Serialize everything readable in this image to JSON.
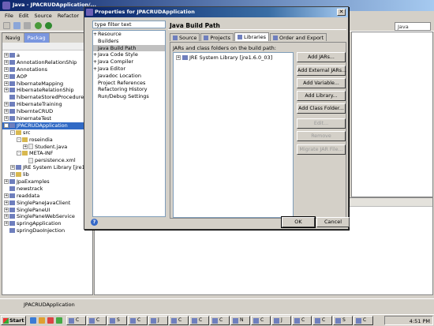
{
  "eclipse": {
    "title": "Java - JPACRUDApplication/...",
    "menu": [
      "File",
      "Edit",
      "Source",
      "Refactor",
      "Naviga"
    ],
    "perspective": "Java",
    "left_tabs": [
      "Navig",
      "Packag"
    ],
    "tree": [
      {
        "label": "a",
        "kind": "project",
        "indent": 0,
        "toggle": "+"
      },
      {
        "label": "AnnotationRelationShip",
        "kind": "project",
        "indent": 0,
        "toggle": "+"
      },
      {
        "label": "Annotations",
        "kind": "project",
        "indent": 0,
        "toggle": "+"
      },
      {
        "label": "AOP",
        "kind": "project",
        "indent": 0,
        "toggle": "+"
      },
      {
        "label": "hibernateMapping",
        "kind": "project",
        "indent": 0,
        "toggle": "+"
      },
      {
        "label": "HibernateRelationShip",
        "kind": "project",
        "indent": 0,
        "toggle": "+"
      },
      {
        "label": "hibernateStoredProcedure",
        "kind": "project",
        "indent": 0,
        "toggle": ""
      },
      {
        "label": "HibernateTraining",
        "kind": "project",
        "indent": 0,
        "toggle": "+"
      },
      {
        "label": "hibernteCRUD",
        "kind": "project",
        "indent": 0,
        "toggle": "+"
      },
      {
        "label": "hinernateTest",
        "kind": "project",
        "indent": 0,
        "toggle": "+"
      },
      {
        "label": "JPACRUDApplication",
        "kind": "project",
        "indent": 0,
        "toggle": "-",
        "selected": true
      },
      {
        "label": "src",
        "kind": "folder",
        "indent": 1,
        "toggle": "-"
      },
      {
        "label": "roseindia",
        "kind": "folder",
        "indent": 2,
        "toggle": "-"
      },
      {
        "label": "Student.java",
        "kind": "file",
        "indent": 3,
        "toggle": "+"
      },
      {
        "label": "META-INF",
        "kind": "folder",
        "indent": 2,
        "toggle": "-"
      },
      {
        "label": "persistence.xml",
        "kind": "file",
        "indent": 3,
        "toggle": ""
      },
      {
        "label": "JRE System Library [jre1.6...",
        "kind": "project",
        "indent": 1,
        "toggle": "+"
      },
      {
        "label": "lib",
        "kind": "folder",
        "indent": 1,
        "toggle": "+"
      },
      {
        "label": "JpaExamples",
        "kind": "project",
        "indent": 0,
        "toggle": "+"
      },
      {
        "label": "newstrack",
        "kind": "project",
        "indent": 0,
        "toggle": ""
      },
      {
        "label": "readdata",
        "kind": "project",
        "indent": 0,
        "toggle": "+"
      },
      {
        "label": "SinglePaneJavaClient",
        "kind": "project",
        "indent": 0,
        "toggle": "+"
      },
      {
        "label": "SinglePaneUI",
        "kind": "project",
        "indent": 0,
        "toggle": "+"
      },
      {
        "label": "SinglePaneWebService",
        "kind": "project",
        "indent": 0,
        "toggle": "+"
      },
      {
        "label": "springApplication",
        "kind": "project",
        "indent": 0,
        "toggle": "+"
      },
      {
        "label": "springDaoInjection",
        "kind": "project",
        "indent": 0,
        "toggle": ""
      }
    ],
    "status": "JPACRUDApplication"
  },
  "dialog": {
    "title": "Properties for JPACRUDApplication",
    "filter_placeholder": "type filter text",
    "nav": [
      {
        "label": "Resource",
        "expand": "+",
        "selected": false
      },
      {
        "label": "Builders",
        "expand": "",
        "selected": false
      },
      {
        "label": "Java Build Path",
        "expand": "",
        "selected": true
      },
      {
        "label": "Java Code Style",
        "expand": "+",
        "selected": false
      },
      {
        "label": "Java Compiler",
        "expand": "+",
        "selected": false
      },
      {
        "label": "Java Editor",
        "expand": "+",
        "selected": false
      },
      {
        "label": "Javadoc Location",
        "expand": "",
        "selected": false
      },
      {
        "label": "Project References",
        "expand": "",
        "selected": false
      },
      {
        "label": "Refactoring History",
        "expand": "",
        "selected": false
      },
      {
        "label": "Run/Debug Settings",
        "expand": "",
        "selected": false
      }
    ],
    "page_title": "Java Build Path",
    "tabs": [
      {
        "label": "Source",
        "active": false
      },
      {
        "label": "Projects",
        "active": false
      },
      {
        "label": "Libraries",
        "active": true
      },
      {
        "label": "Order and Export",
        "active": false
      }
    ],
    "jars_label": "JARs and class folders on the build path:",
    "jars": [
      {
        "label": "JRE System Library [jre1.6.0_03]"
      }
    ],
    "buttons": [
      {
        "label": "Add JARs...",
        "enabled": true
      },
      {
        "label": "Add External JARs...",
        "enabled": true
      },
      {
        "label": "Add Variable...",
        "enabled": true
      },
      {
        "label": "Add Library...",
        "enabled": true
      },
      {
        "label": "Add Class Folder...",
        "enabled": true
      },
      {
        "label": "Edit...",
        "enabled": false
      },
      {
        "label": "Remove",
        "enabled": false
      },
      {
        "label": "Migrate JAR File...",
        "enabled": false
      }
    ],
    "ok_label": "OK",
    "cancel_label": "Cancel",
    "help_label": "?"
  },
  "taskbar": {
    "start_label": "Start",
    "buttons": [
      "C",
      "C",
      "S",
      "C",
      "J",
      "C",
      "C",
      "C",
      "N",
      "C",
      "J",
      "C",
      "C",
      "S",
      "C"
    ],
    "clock": "4:51 PM"
  },
  "colors": {
    "title_blue": "#0a246a",
    "selection": "#316ac5",
    "desktop": "#3a6ea5"
  }
}
